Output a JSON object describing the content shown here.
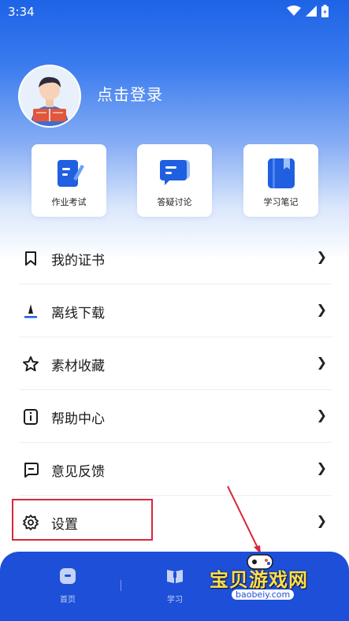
{
  "status_bar": {
    "time": "3:34",
    "icons": [
      "wifi-icon",
      "signal-icon",
      "battery-icon"
    ]
  },
  "profile": {
    "login_text": "点击登录"
  },
  "quick_actions": [
    {
      "label": "作业考试",
      "icon": "homework-exam-icon"
    },
    {
      "label": "答疑讨论",
      "icon": "qa-discussion-icon"
    },
    {
      "label": "学习笔记",
      "icon": "study-notes-icon"
    }
  ],
  "menu": [
    {
      "label": "我的证书",
      "icon": "bookmark-icon"
    },
    {
      "label": "离线下载",
      "icon": "download-icon"
    },
    {
      "label": "素材收藏",
      "icon": "star-icon"
    },
    {
      "label": "帮助中心",
      "icon": "info-icon"
    },
    {
      "label": "意见反馈",
      "icon": "feedback-icon"
    },
    {
      "label": "设置",
      "icon": "gear-icon"
    }
  ],
  "bottom_nav": [
    {
      "label": "首页",
      "icon": "home-icon"
    },
    {
      "label": "学习",
      "icon": "book-icon"
    }
  ],
  "watermark": {
    "title": "宝贝游戏网",
    "url": "baobeiy.com"
  },
  "colors": {
    "primary": "#1d4fd8",
    "gradient_top": "#1d63e6",
    "highlight": "#d7283a",
    "watermark_text": "#ffe14a"
  }
}
